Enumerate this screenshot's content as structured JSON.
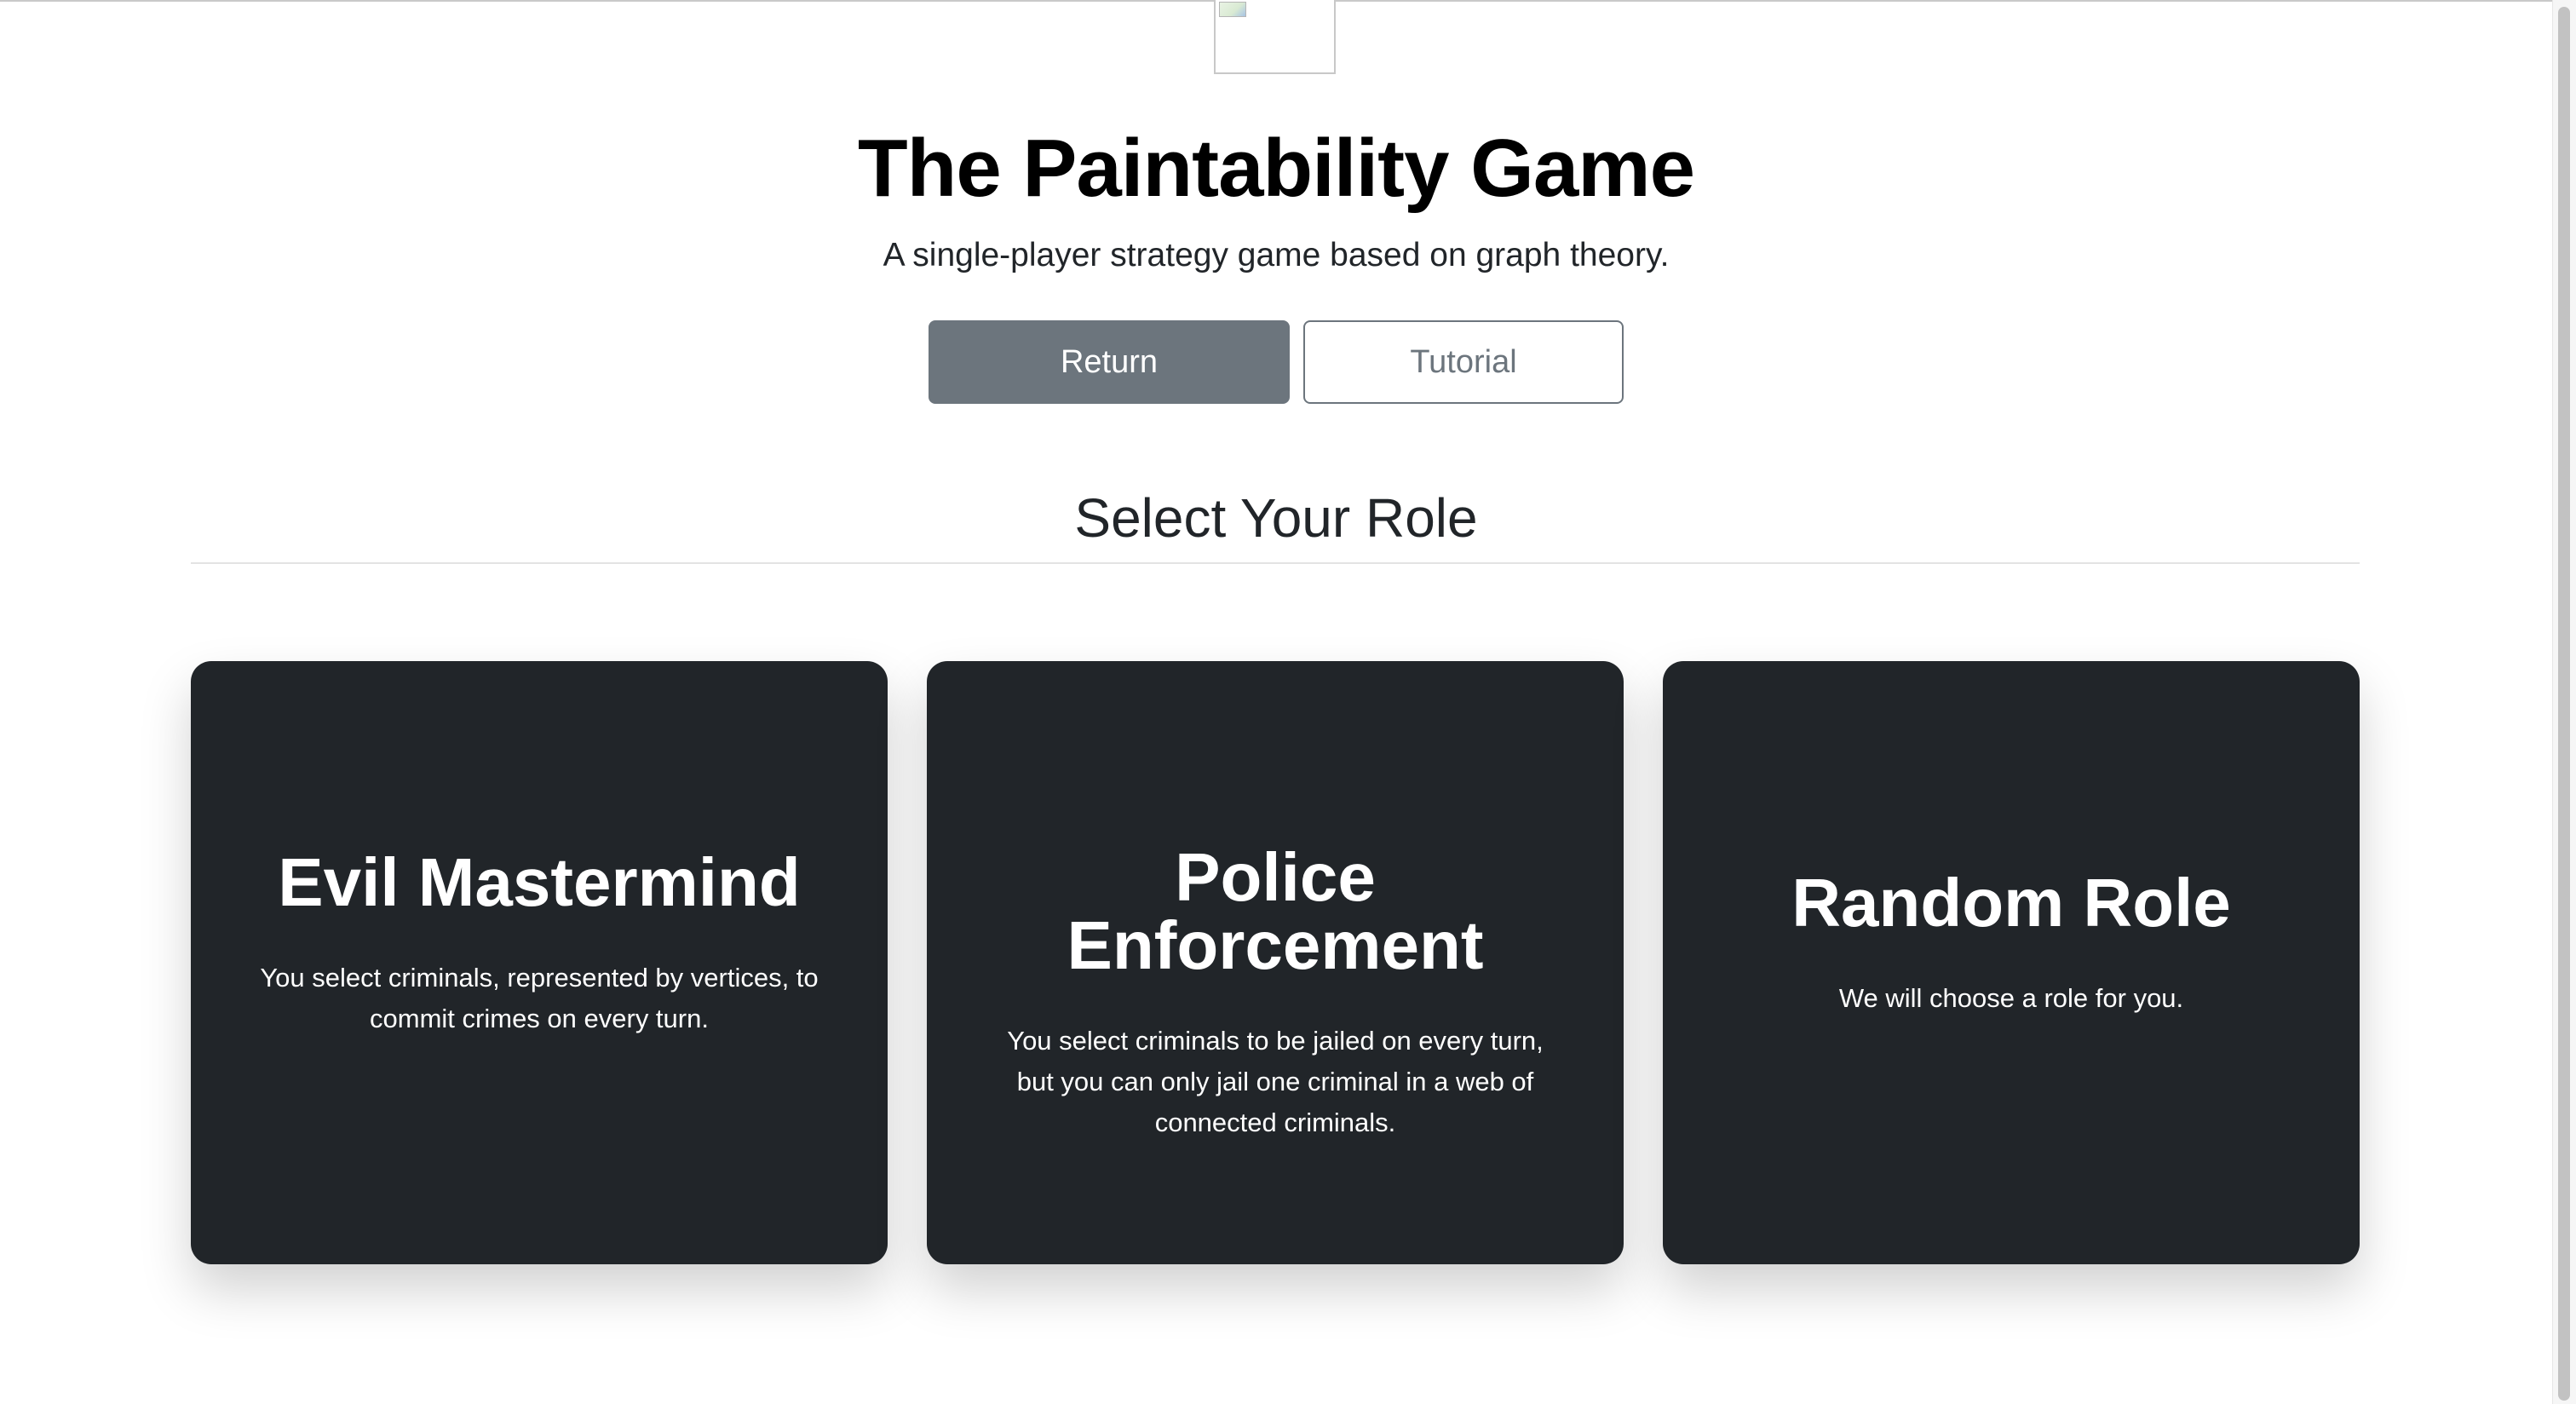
{
  "header": {
    "title": "The Paintability Game",
    "subtitle": "A single-player strategy game based on graph theory."
  },
  "buttons": {
    "return_label": "Return",
    "tutorial_label": "Tutorial"
  },
  "section": {
    "title": "Select Your Role"
  },
  "roles": [
    {
      "title": "Evil Mastermind",
      "description": "You select criminals, represented by vertices, to commit crimes on every turn."
    },
    {
      "title": "Police Enforcement",
      "description": "You select criminals to be jailed on every turn, but you can only jail one criminal in a web of connected criminals."
    },
    {
      "title": "Random Role",
      "description": "We will choose a role for you."
    }
  ],
  "colors": {
    "card_background": "#212529",
    "return_button": "#6c757d",
    "tutorial_border": "#6c757d"
  }
}
